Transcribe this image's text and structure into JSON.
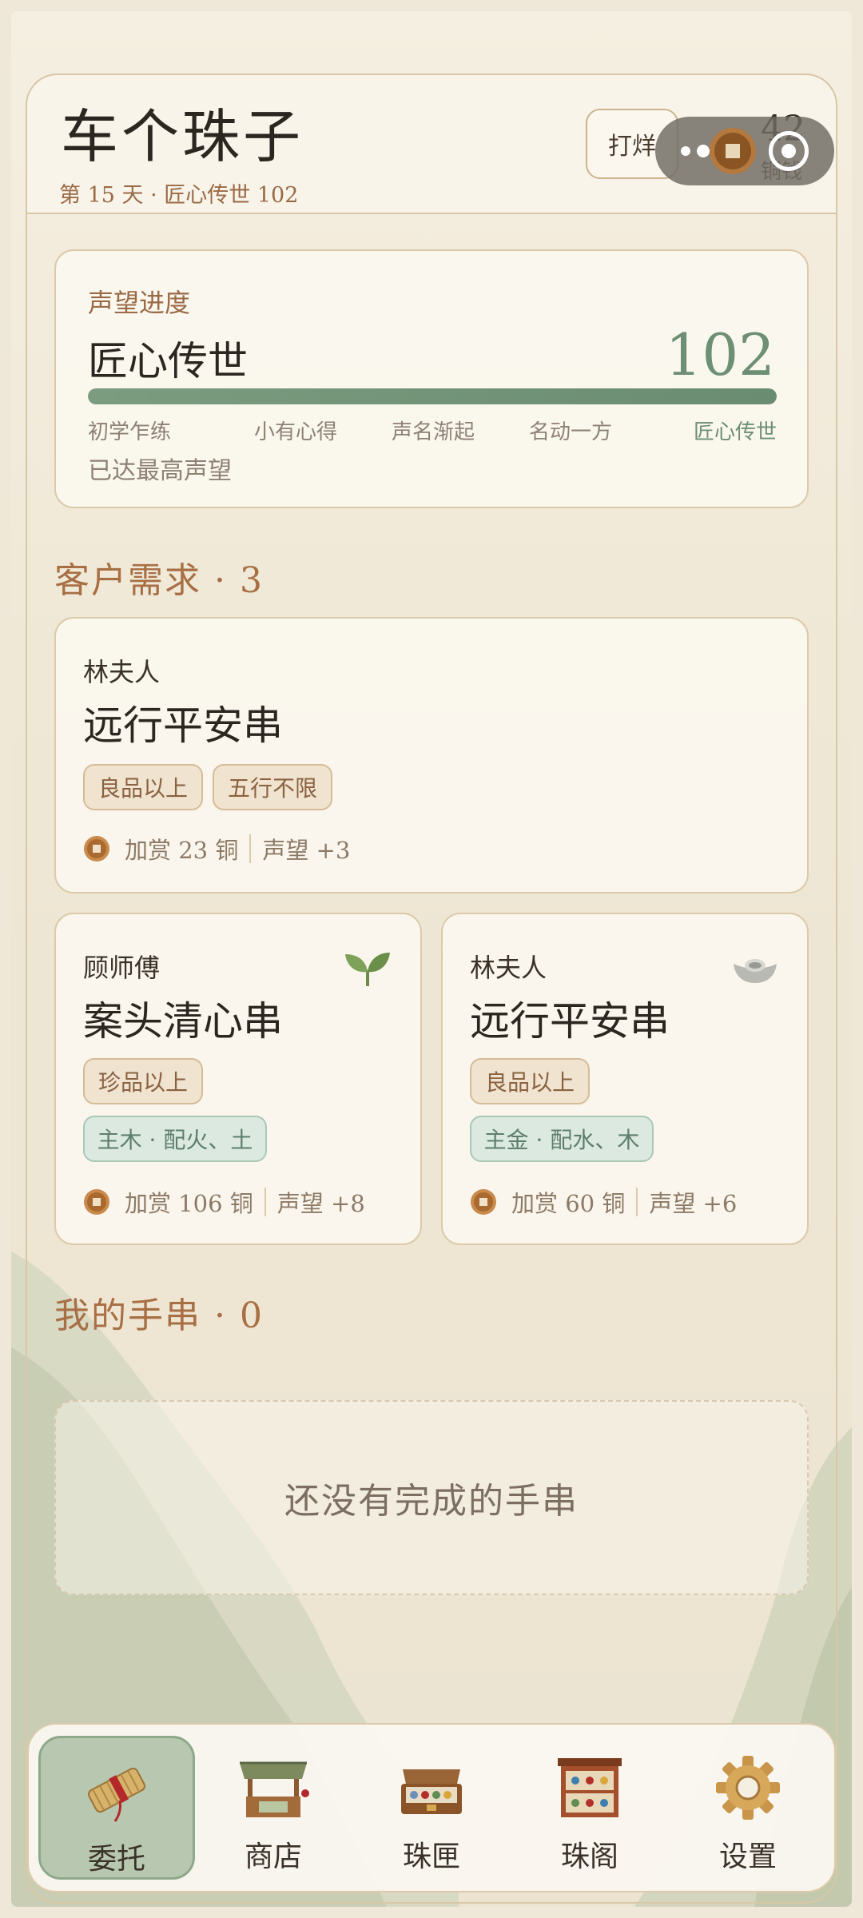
{
  "header": {
    "title": "车个珠子",
    "subtitle": "第 15 天 · 匠心传世 102",
    "dayang_button": "打烊",
    "coins": {
      "count": "42",
      "label": "铜钱"
    }
  },
  "reputation": {
    "label": "声望进度",
    "level_name": "匠心传世",
    "value": "102",
    "progress": 1.0,
    "stages": [
      "初学乍练",
      "小有心得",
      "声名渐起",
      "名动一方",
      "匠心传世"
    ],
    "note": "已达最高声望"
  },
  "requests": {
    "section_title": "客户需求 · 3",
    "items": [
      {
        "customer": "林夫人",
        "title": "远行平安串",
        "tags": [
          "良品以上",
          "五行不限"
        ],
        "reward": "加赏 23 铜",
        "reputation": "声望 +3"
      },
      {
        "customer": "顾师傅",
        "title": "案头清心串",
        "tags": [
          "珍品以上"
        ],
        "element_tag": "主木 · 配火、土",
        "reward": "加赏 106 铜",
        "reputation": "声望 +8",
        "icon": "sprout-icon"
      },
      {
        "customer": "林夫人",
        "title": "远行平安串",
        "tags": [
          "良品以上"
        ],
        "element_tag": "主金 · 配水、木",
        "reward": "加赏 60 铜",
        "reputation": "声望 +6",
        "icon": "silver-ingot-icon"
      }
    ]
  },
  "bracelets": {
    "section_title": "我的手串 · 0",
    "empty_text": "还没有完成的手串"
  },
  "tabbar": {
    "items": [
      {
        "label": "委托",
        "icon": "scroll-icon",
        "active": true
      },
      {
        "label": "商店",
        "icon": "shop-stall-icon",
        "active": false
      },
      {
        "label": "珠匣",
        "icon": "bead-box-icon",
        "active": false
      },
      {
        "label": "珠阁",
        "icon": "bead-cabinet-icon",
        "active": false
      },
      {
        "label": "设置",
        "icon": "gear-icon",
        "active": false
      }
    ]
  },
  "colors": {
    "accent_green": "#6d8f74",
    "accent_brown": "#a86f44",
    "tag_tan": "#f0e3cf",
    "tag_green": "#dbe9e1",
    "active_tab": "#b7c7b0"
  }
}
